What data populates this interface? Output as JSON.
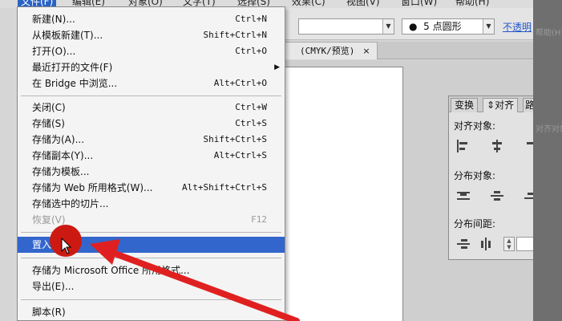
{
  "menubar": {
    "items": [
      "文件(F)",
      "编辑(E)",
      "对象(O)",
      "文字(T)",
      "选择(S)",
      "效果(C)",
      "视图(V)",
      "窗口(W)",
      "帮助(H)"
    ]
  },
  "toolbar": {
    "brush_value": "5 点圆形",
    "opacity_link": "不透明"
  },
  "document_tab": {
    "label": "(CMYK/预览)",
    "close": "×"
  },
  "align_panel": {
    "tabs": [
      "变换",
      "对齐",
      "路"
    ],
    "align_objects_label": "对齐对象:",
    "distribute_objects_label": "分布对象:",
    "distribute_spacing_label": "分布间距:"
  },
  "right_edge": {
    "ghost_labels": [
      "帮助(H)",
      "对齐对象"
    ]
  },
  "file_menu": {
    "items": [
      {
        "label": "新建(N)...",
        "shortcut": "Ctrl+N"
      },
      {
        "label": "从模板新建(T)...",
        "shortcut": "Shift+Ctrl+N"
      },
      {
        "label": "打开(O)...",
        "shortcut": "Ctrl+O"
      },
      {
        "label": "最近打开的文件(F)",
        "shortcut": ""
      },
      {
        "label": "在 Bridge 中浏览...",
        "shortcut": "Alt+Ctrl+O"
      },
      {
        "label": "关闭(C)",
        "shortcut": "Ctrl+W"
      },
      {
        "label": "存储(S)",
        "shortcut": "Ctrl+S"
      },
      {
        "label": "存储为(A)...",
        "shortcut": "Shift+Ctrl+S"
      },
      {
        "label": "存储副本(Y)...",
        "shortcut": "Alt+Ctrl+S"
      },
      {
        "label": "存储为模板...",
        "shortcut": ""
      },
      {
        "label": "存储为 Web 所用格式(W)...",
        "shortcut": "Alt+Shift+Ctrl+S"
      },
      {
        "label": "存储选中的切片...",
        "shortcut": ""
      },
      {
        "label": "恢复(V)",
        "shortcut": "F12"
      },
      {
        "label": "置入(L)...",
        "shortcut": ""
      },
      {
        "label": "存储为 Microsoft Office 所用格式...",
        "shortcut": ""
      },
      {
        "label": "导出(E)...",
        "shortcut": ""
      },
      {
        "label": "脚本(R)",
        "shortcut": ""
      }
    ]
  },
  "colors": {
    "highlight": "#3366cc",
    "annotation_red": "#cc1a12"
  }
}
